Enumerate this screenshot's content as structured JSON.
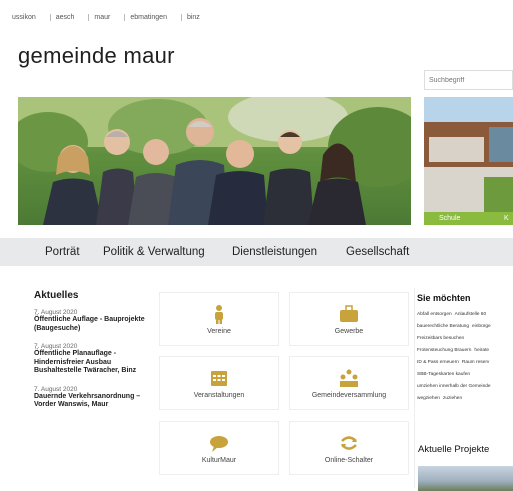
{
  "topnav": {
    "items": [
      "ussikon",
      "aesch",
      "maur",
      "ebmatingen",
      "binz"
    ]
  },
  "logo": "gemeinde maur",
  "search": {
    "placeholder": "Suchbegriff"
  },
  "thumb": {
    "caption": "Schule",
    "caption2": "K"
  },
  "mainnav": {
    "items": [
      "Porträt",
      "Politik & Verwaltung",
      "Dienstleistungen",
      "Gesellschaft"
    ]
  },
  "news": {
    "heading": "Aktuelles",
    "items": [
      {
        "date": "7. August 2020",
        "title": "Öffentliche Auflage - Bauprojekte (Baugesuche)"
      },
      {
        "date": "7. August 2020",
        "title": "Öffentliche Planauflage - Hindernisfreier Ausbau Bushaltestelle Twäracher, Binz"
      },
      {
        "date": "7. August 2020",
        "title": "Dauernde Verkehrsanordnung – Vorder Wanswis, Maur"
      }
    ]
  },
  "tiles": [
    {
      "label": "Vereine",
      "icon": "person-icon"
    },
    {
      "label": "Gewerbe",
      "icon": "briefcase-icon"
    },
    {
      "label": "Veranstaltungen",
      "icon": "calendar-icon"
    },
    {
      "label": "Gemeindeversammlung",
      "icon": "assembly-icon"
    },
    {
      "label": "KulturMaur",
      "icon": "speech-bubble-icon"
    },
    {
      "label": "Online-Schalter",
      "icon": "exchange-icon"
    }
  ],
  "sidebar": {
    "heading": "Sie möchten",
    "tags": [
      "Abfall entsorgen",
      "Anlaufstelle 60",
      "bauerechtliche Beratung",
      "einbürge",
      "Freizeitbars besuchen",
      "Frotensteuchung Brauern",
      "heirate",
      "ID & Pass erneuern",
      "Raum reserv",
      "SBB-Tageskarten kaufen",
      "umziehen innerhalb der Gemeinde",
      "wegziehen",
      "zuziehen"
    ]
  },
  "projects": {
    "heading": "Aktuelle Projekte"
  },
  "colors": {
    "accent": "#8aba3e",
    "nav_bg": "#e7e9ea",
    "icon": "#c8a23a"
  }
}
